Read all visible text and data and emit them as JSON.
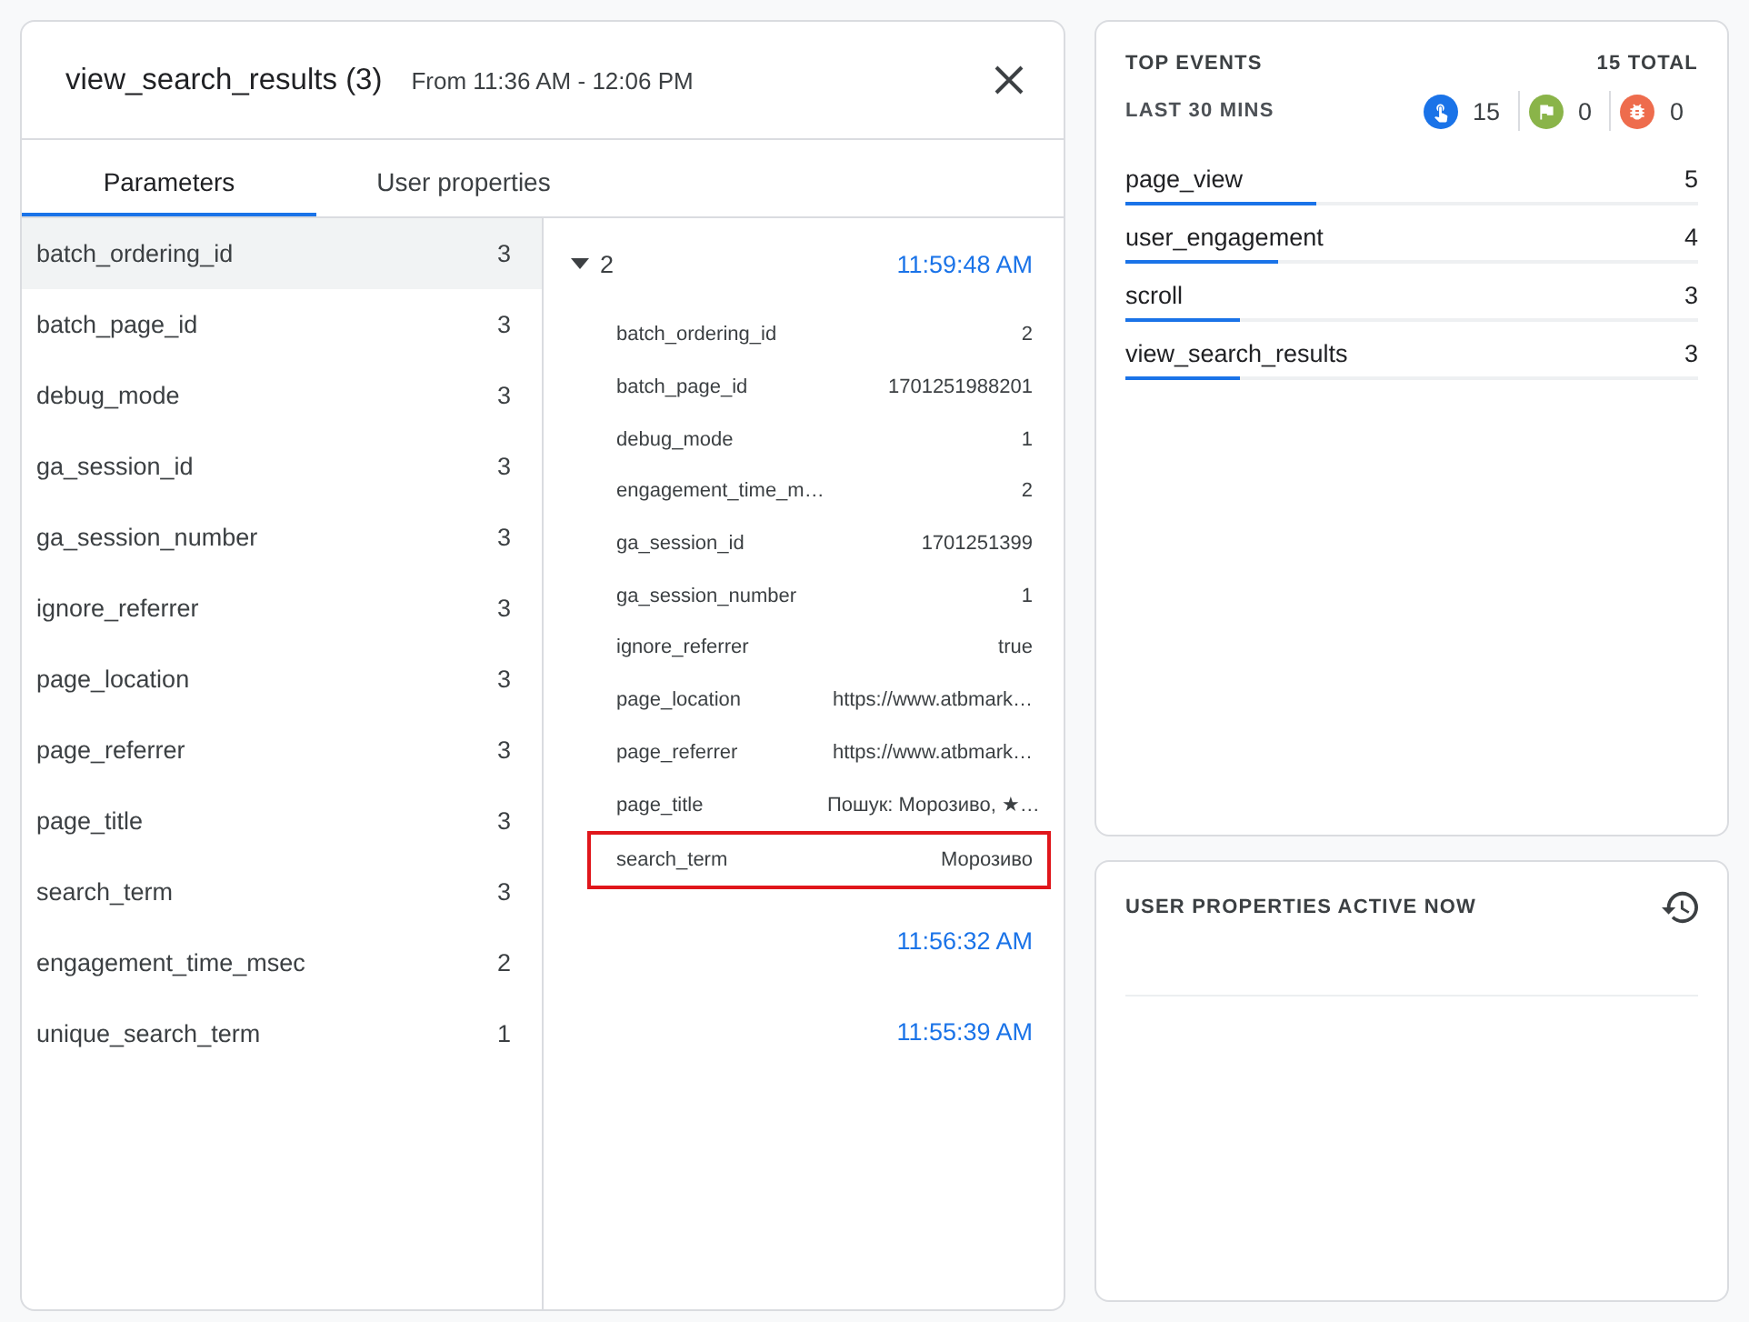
{
  "event_panel": {
    "title": "view_search_results (3)",
    "time_range": "From 11:36 AM - 12:06 PM",
    "tabs": [
      {
        "label": "Parameters",
        "selected": true
      },
      {
        "label": "User properties",
        "selected": false
      }
    ],
    "parameters": [
      {
        "name": "batch_ordering_id",
        "count": "3",
        "selected": true
      },
      {
        "name": "batch_page_id",
        "count": "3",
        "selected": false
      },
      {
        "name": "debug_mode",
        "count": "3",
        "selected": false
      },
      {
        "name": "ga_session_id",
        "count": "3",
        "selected": false
      },
      {
        "name": "ga_session_number",
        "count": "3",
        "selected": false
      },
      {
        "name": "ignore_referrer",
        "count": "3",
        "selected": false
      },
      {
        "name": "page_location",
        "count": "3",
        "selected": false
      },
      {
        "name": "page_referrer",
        "count": "3",
        "selected": false
      },
      {
        "name": "page_title",
        "count": "3",
        "selected": false
      },
      {
        "name": "search_term",
        "count": "3",
        "selected": false
      },
      {
        "name": "engagement_time_msec",
        "count": "2",
        "selected": false
      },
      {
        "name": "unique_search_term",
        "count": "1",
        "selected": false
      }
    ],
    "events": [
      {
        "count": "2",
        "time": "11:59:48 AM",
        "expanded": true,
        "params": [
          {
            "key": "batch_ordering_id",
            "value": "2",
            "highlighted": false
          },
          {
            "key": "batch_page_id",
            "value": "1701251988201",
            "highlighted": false
          },
          {
            "key": "debug_mode",
            "value": "1",
            "highlighted": false
          },
          {
            "key": "engagement_time_m…",
            "value": "2",
            "highlighted": false
          },
          {
            "key": "ga_session_id",
            "value": "1701251399",
            "highlighted": false
          },
          {
            "key": "ga_session_number",
            "value": "1",
            "highlighted": false
          },
          {
            "key": "ignore_referrer",
            "value": "true",
            "highlighted": false
          },
          {
            "key": "page_location",
            "value": "https://www.atbmark…",
            "highlighted": false
          },
          {
            "key": "page_referrer",
            "value": "https://www.atbmark…",
            "highlighted": false
          },
          {
            "key": "page_title",
            "value": "Пошук: Морозиво, ★…",
            "highlighted": false
          },
          {
            "key": "search_term",
            "value": "Морозиво",
            "highlighted": true
          }
        ]
      },
      {
        "time": "11:56:32 AM",
        "expanded": false
      },
      {
        "time": "11:55:39 AM",
        "expanded": false
      }
    ]
  },
  "top_events": {
    "title": "TOP EVENTS",
    "total": "15 TOTAL",
    "period": "LAST 30 MINS",
    "counters": [
      {
        "kind": "pointer",
        "value": "15",
        "color": "#1a73e8"
      },
      {
        "kind": "flag",
        "value": "0",
        "color": "#8ab449"
      },
      {
        "kind": "bug",
        "value": "0",
        "color": "#ee6c4d"
      }
    ],
    "events": [
      {
        "name": "page_view",
        "count": "5",
        "level": 0.333
      },
      {
        "name": "user_engagement",
        "count": "4",
        "level": 0.267
      },
      {
        "name": "scroll",
        "count": "3",
        "level": 0.2
      },
      {
        "name": "view_search_results",
        "count": "3",
        "level": 0.2
      }
    ]
  },
  "user_properties": {
    "title": "USER PROPERTIES ACTIVE NOW"
  }
}
